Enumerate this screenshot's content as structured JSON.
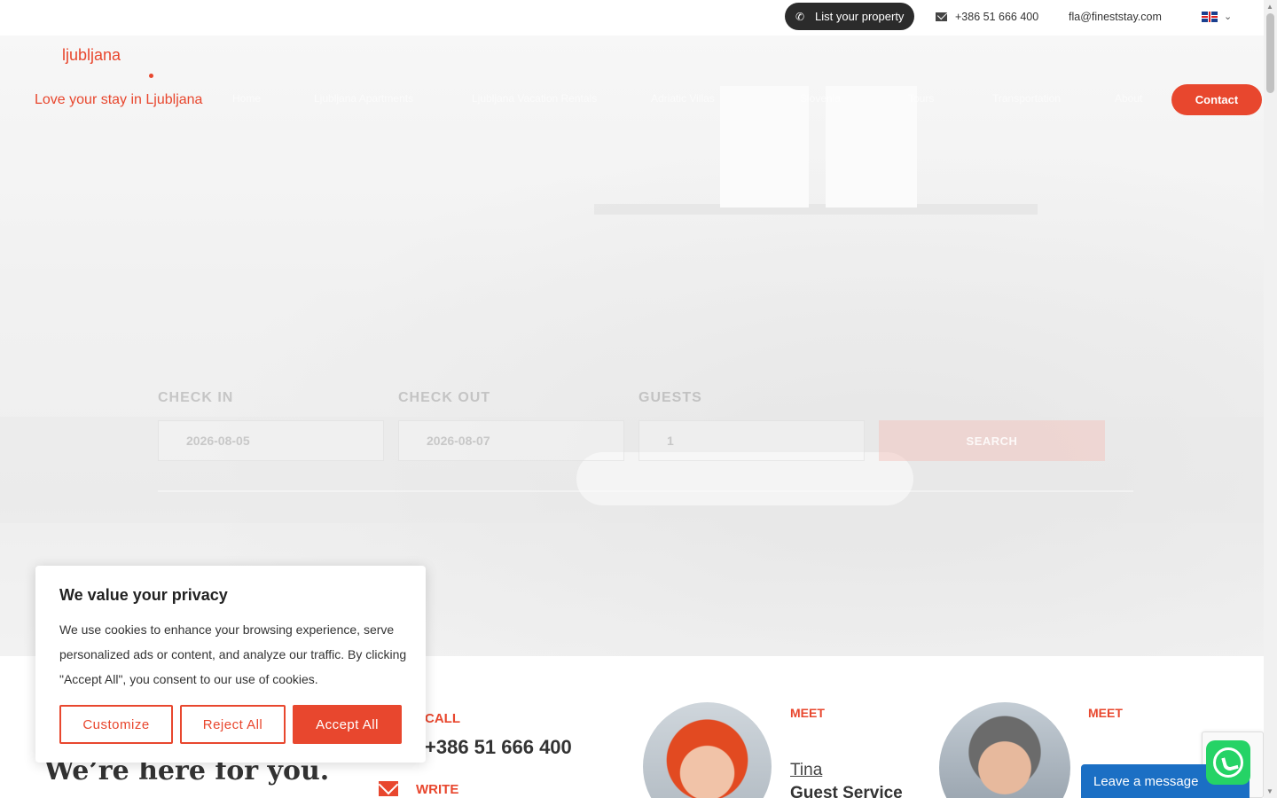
{
  "topbar": {
    "list_property": "List your property",
    "phone": "+386 51 666 400",
    "email": "fla@fineststay.com",
    "language": "EN"
  },
  "header": {
    "logo_city": "ljubljana",
    "tagline": "Love your stay in Ljubljana",
    "nav": [
      "Home",
      "Ljubljana Apartments",
      "Ljubljana Vacation Rentals",
      "Adriatic Villas",
      "Slovenia",
      "Tours",
      "Transportation",
      "About"
    ],
    "contact": "Contact"
  },
  "booking": {
    "check_in_label": "CHECK IN",
    "check_in_value": "2026-08-05",
    "check_out_label": "CHECK OUT",
    "check_out_value": "2026-08-07",
    "guests_label": "GUESTS",
    "guests_value": "1",
    "search": "SEARCH"
  },
  "lower": {
    "heading": "We’re here for you.",
    "call_label": "CALL",
    "call_number": "+386 51 666 400",
    "write_label": "WRITE",
    "meet1_label": "MEET",
    "meet1_name": "Tina",
    "meet1_role": "Guest Service",
    "meet2_label": "MEET"
  },
  "cookie": {
    "title": "We value your privacy",
    "body": "We use cookies to enhance your browsing experience, serve personalized ads or content, and analyze our traffic. By clicking \"Accept All\", you consent to our use of cookies.",
    "customize": "Customize",
    "reject": "Reject All",
    "accept": "Accept All"
  },
  "widgets": {
    "leave_message": "Leave a message"
  },
  "colors": {
    "accent": "#e8472e",
    "dark_pill": "#2b2b2b",
    "whatsapp": "#25d366",
    "chat": "#1b6fc4"
  }
}
